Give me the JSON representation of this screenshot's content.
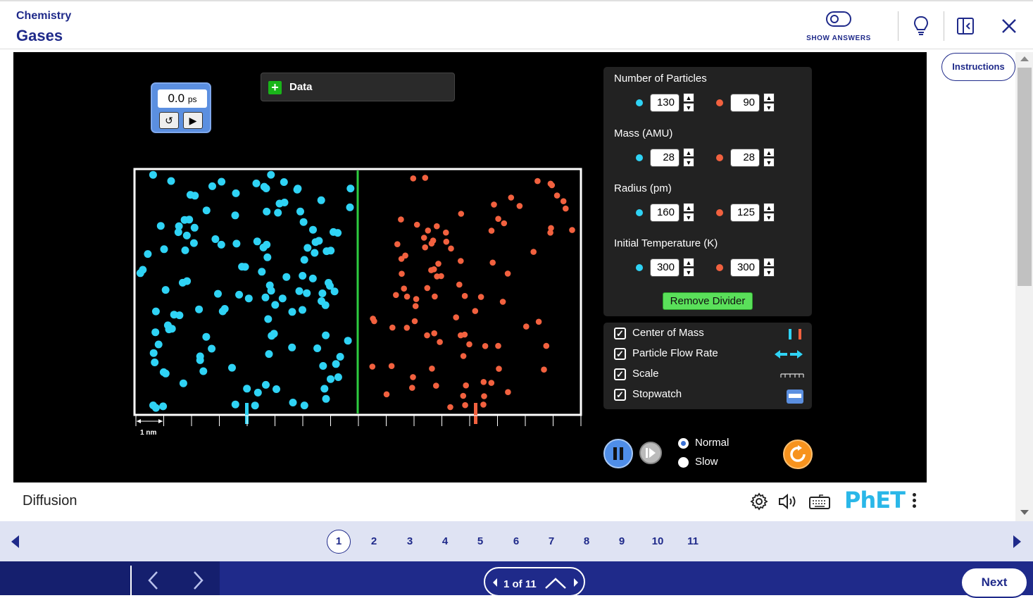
{
  "header": {
    "course": "Chemistry",
    "title": "Gases",
    "show_answers_label": "SHOW ANSWERS"
  },
  "sim": {
    "stopwatch": {
      "value": "0.0",
      "unit": "ps"
    },
    "data_panel_label": "Data",
    "scale_label": "1 nm",
    "params": {
      "particles": {
        "label": "Number of Particles",
        "cyan": "130",
        "red": "90"
      },
      "mass": {
        "label": "Mass (AMU)",
        "cyan": "28",
        "red": "28"
      },
      "radius": {
        "label": "Radius (pm)",
        "cyan": "160",
        "red": "125"
      },
      "temperature": {
        "label": "Initial Temperature (K)",
        "cyan": "300",
        "red": "300"
      }
    },
    "remove_divider_label": "Remove Divider",
    "checkboxes": [
      {
        "label": "Center of Mass",
        "checked": true
      },
      {
        "label": "Particle Flow Rate",
        "checked": true
      },
      {
        "label": "Scale",
        "checked": true
      },
      {
        "label": "Stopwatch",
        "checked": true
      }
    ],
    "speed": {
      "normal_label": "Normal",
      "slow_label": "Slow",
      "selected": "Normal"
    },
    "screen_name": "Diffusion",
    "logo_text": "PhET",
    "colors": {
      "cyan_particle": "#2fd3f5",
      "red_particle": "#f2613f",
      "divider": "#2ecc40",
      "accent": "#1f2a8a"
    }
  },
  "instructions_label": "Instructions",
  "page_nav": {
    "pages": [
      "1",
      "2",
      "3",
      "4",
      "5",
      "6",
      "7",
      "8",
      "9",
      "10",
      "11"
    ],
    "current": "1"
  },
  "bottom_bar": {
    "page_indicator": "1 of 11",
    "next_label": "Next"
  }
}
